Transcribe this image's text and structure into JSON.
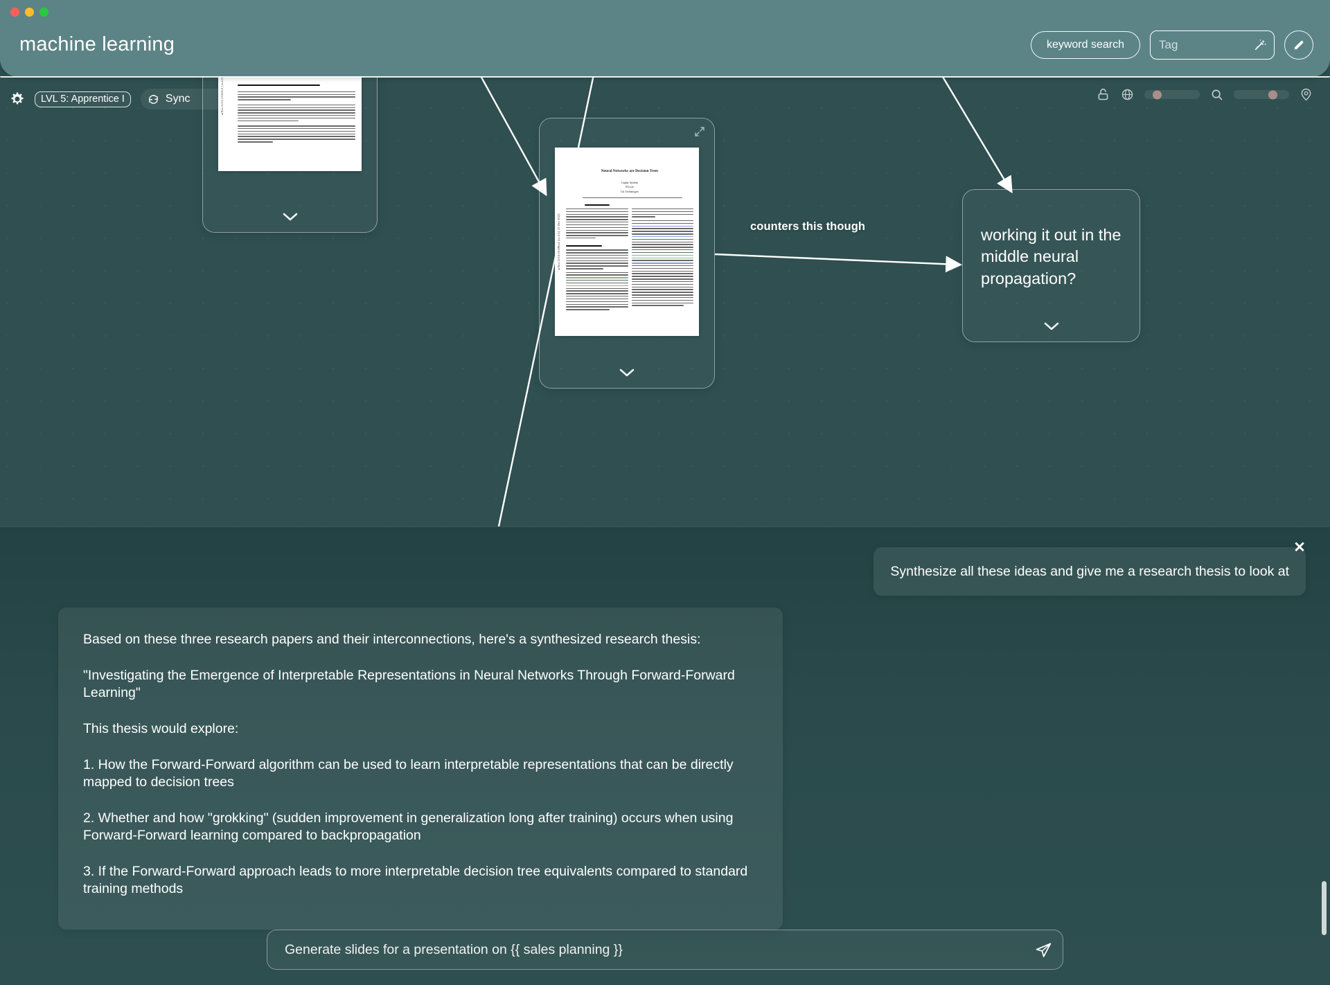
{
  "window": {
    "traffic_lights": [
      "close",
      "minimize",
      "maximize"
    ],
    "title": "machine learning"
  },
  "header": {
    "keyword_search_label": "keyword search",
    "tag_placeholder": "Tag",
    "magic_tag_icon": "magic-wand-icon",
    "edit_icon": "pencil-icon"
  },
  "left_toolbar": {
    "gear_icon": "gear-icon",
    "level_label": "LVL 5: Apprentice I",
    "sync_label": "Sync",
    "sync_icon": "sync-icon",
    "sync_status_icon": "check-circle-icon"
  },
  "right_toolbar": {
    "lock_icon": "unlock-icon",
    "globe_icon": "globe-icon",
    "search_icon": "search-icon",
    "locate_icon": "map-pin-icon",
    "slider_a_value": 22,
    "slider_b_value": 62
  },
  "canvas": {
    "background_color": "#2f4f50",
    "edge_color": "#ffffff",
    "nodes": [
      {
        "id": "paper-forward-forward",
        "type": "paper-card",
        "paper": {
          "arxiv_side_id": "arXiv:2212.13345v1  [cs.LG]",
          "section_heading": "1   What is wrong with backpropagation"
        }
      },
      {
        "id": "paper-neural-networks-are-decision-trees",
        "type": "paper-card",
        "paper": {
          "title": "Neural Networks are Decision Trees",
          "author": "Caglar Aytekin",
          "affiliation_1": "KUcoin",
          "affiliation_2": "Ltd. Technologies",
          "abstract_heading": "Abstract",
          "intro_heading": "1. Introduction",
          "arxiv_side_id": "arXiv:2210.05189v4  [cs.LG]  25 Oct 2022"
        }
      },
      {
        "id": "note-middle-neural-propagation",
        "type": "text-card",
        "text": "working it out in the middle neural propagation?"
      }
    ],
    "edge_labels": [
      {
        "id": "edge-label-counters",
        "text": "counters this though"
      }
    ]
  },
  "chat": {
    "close_icon": "close-icon",
    "user_message": "Synthesize all these ideas and give me a research thesis to look at",
    "assistant_message": {
      "paragraphs": [
        "Based on these three research papers and their interconnections, here's a synthesized research thesis:",
        "\"Investigating the Emergence of Interpretable Representations in Neural Networks Through Forward-Forward Learning\"",
        "This thesis would explore:",
        "1. How the Forward-Forward algorithm can be used to learn interpretable representations that can be directly mapped to decision trees",
        "2. Whether and how \"grokking\" (sudden improvement in generalization long after training) occurs when using Forward-Forward learning compared to backpropagation",
        "3. If the Forward-Forward approach leads to more interpretable decision tree equivalents compared to standard training methods"
      ]
    }
  },
  "composer": {
    "value": "Generate slides for a presentation on {{ sales planning }}",
    "send_icon": "send-icon"
  }
}
